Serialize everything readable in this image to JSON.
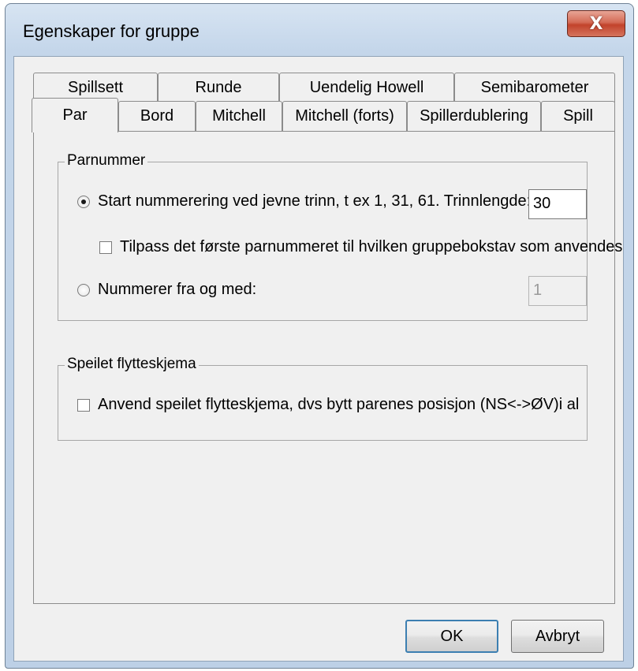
{
  "window": {
    "title": "Egenskaper for gruppe",
    "close_glyph": "X"
  },
  "tabs": {
    "row1": [
      "Spillsett",
      "Runde",
      "Uendelig Howell",
      "Semibarometer"
    ],
    "row2": [
      "Par",
      "Bord",
      "Mitchell",
      "Mitchell (forts)",
      "Spillerdublering",
      "Spill"
    ],
    "selected": "Par"
  },
  "parnummer": {
    "legend": "Parnummer",
    "radio_start": {
      "label": "Start nummerering ved jevne trinn, t ex 1, 31, 61. Trinnlengde:",
      "checked": true
    },
    "step_value": "30",
    "check_tilpass": {
      "label": "Tilpass det første parnummeret til hvilken gruppebokstav som anvendes",
      "checked": false
    },
    "radio_from": {
      "label": "Nummerer fra og med:",
      "checked": false
    },
    "from_value": "1"
  },
  "speilet": {
    "legend": "Speilet flytteskjema",
    "check_speilet": {
      "label": "Anvend speilet flytteskjema, dvs bytt parenes posisjon (NS<->ØV)i alle runc",
      "checked": false
    }
  },
  "buttons": {
    "ok": "OK",
    "cancel": "Avbryt"
  }
}
